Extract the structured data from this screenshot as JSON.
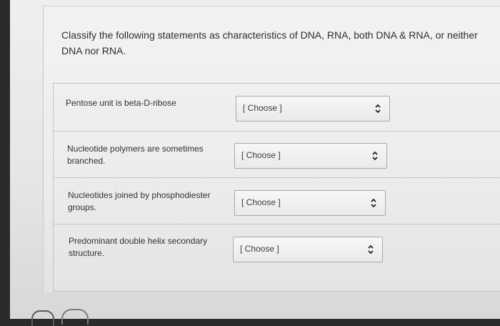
{
  "question": {
    "prompt": "Classify the following statements as characteristics of DNA, RNA, both DNA & RNA, or neither DNA nor RNA."
  },
  "rows": [
    {
      "statement": "Pentose unit is beta-D-ribose",
      "select_value": "[ Choose ]"
    },
    {
      "statement": "Nucleotide polymers are sometimes branched.",
      "select_value": "[ Choose ]"
    },
    {
      "statement": "Nucleotides joined by phosphodiester groups.",
      "select_value": "[ Choose ]"
    },
    {
      "statement": "Predominant double helix secondary structure.",
      "select_value": "[ Choose ]"
    }
  ],
  "icons": {
    "select_indicator": "chevron-up-down-icon"
  }
}
